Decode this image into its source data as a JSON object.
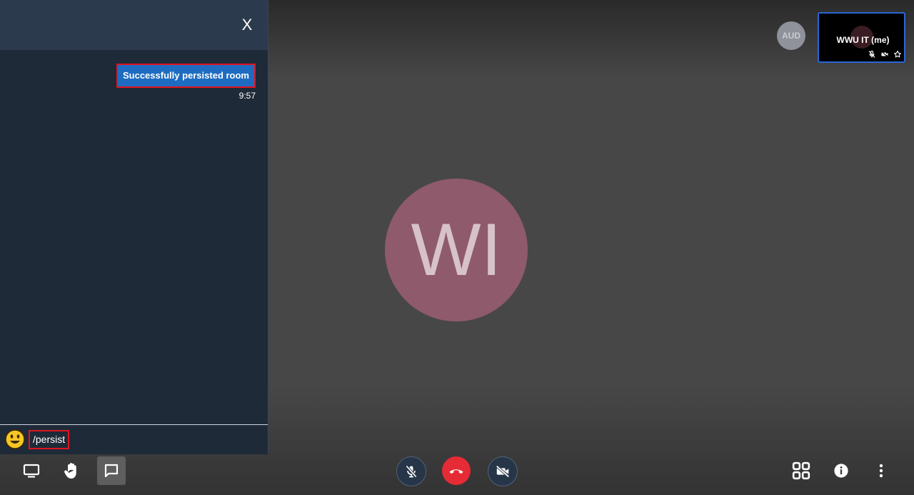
{
  "chat": {
    "close_label": "X",
    "message": {
      "text": "Successfully persisted room",
      "time": "9:57"
    },
    "input": {
      "value": "/persist"
    }
  },
  "main": {
    "avatar_initials": "WI"
  },
  "participants": {
    "aud_initials": "AUD",
    "self_name": "WWU IT (me)"
  },
  "toolbar": {
    "left": [
      "screen-share-icon",
      "raise-hand-icon",
      "chat-icon"
    ],
    "center": [
      "microphone-muted-icon",
      "hangup-icon",
      "camera-off-icon"
    ],
    "right": [
      "tile-view-icon",
      "info-icon",
      "more-options-icon"
    ]
  },
  "colors": {
    "chat_panel": "#1f2a38",
    "chat_header": "#2b3a4c",
    "bubble": "#1e6cc1",
    "highlight": "#e0141e",
    "hangup": "#e52b35",
    "avatar_main": "#8f5a6c",
    "self_tile_border": "#2a66d6"
  }
}
